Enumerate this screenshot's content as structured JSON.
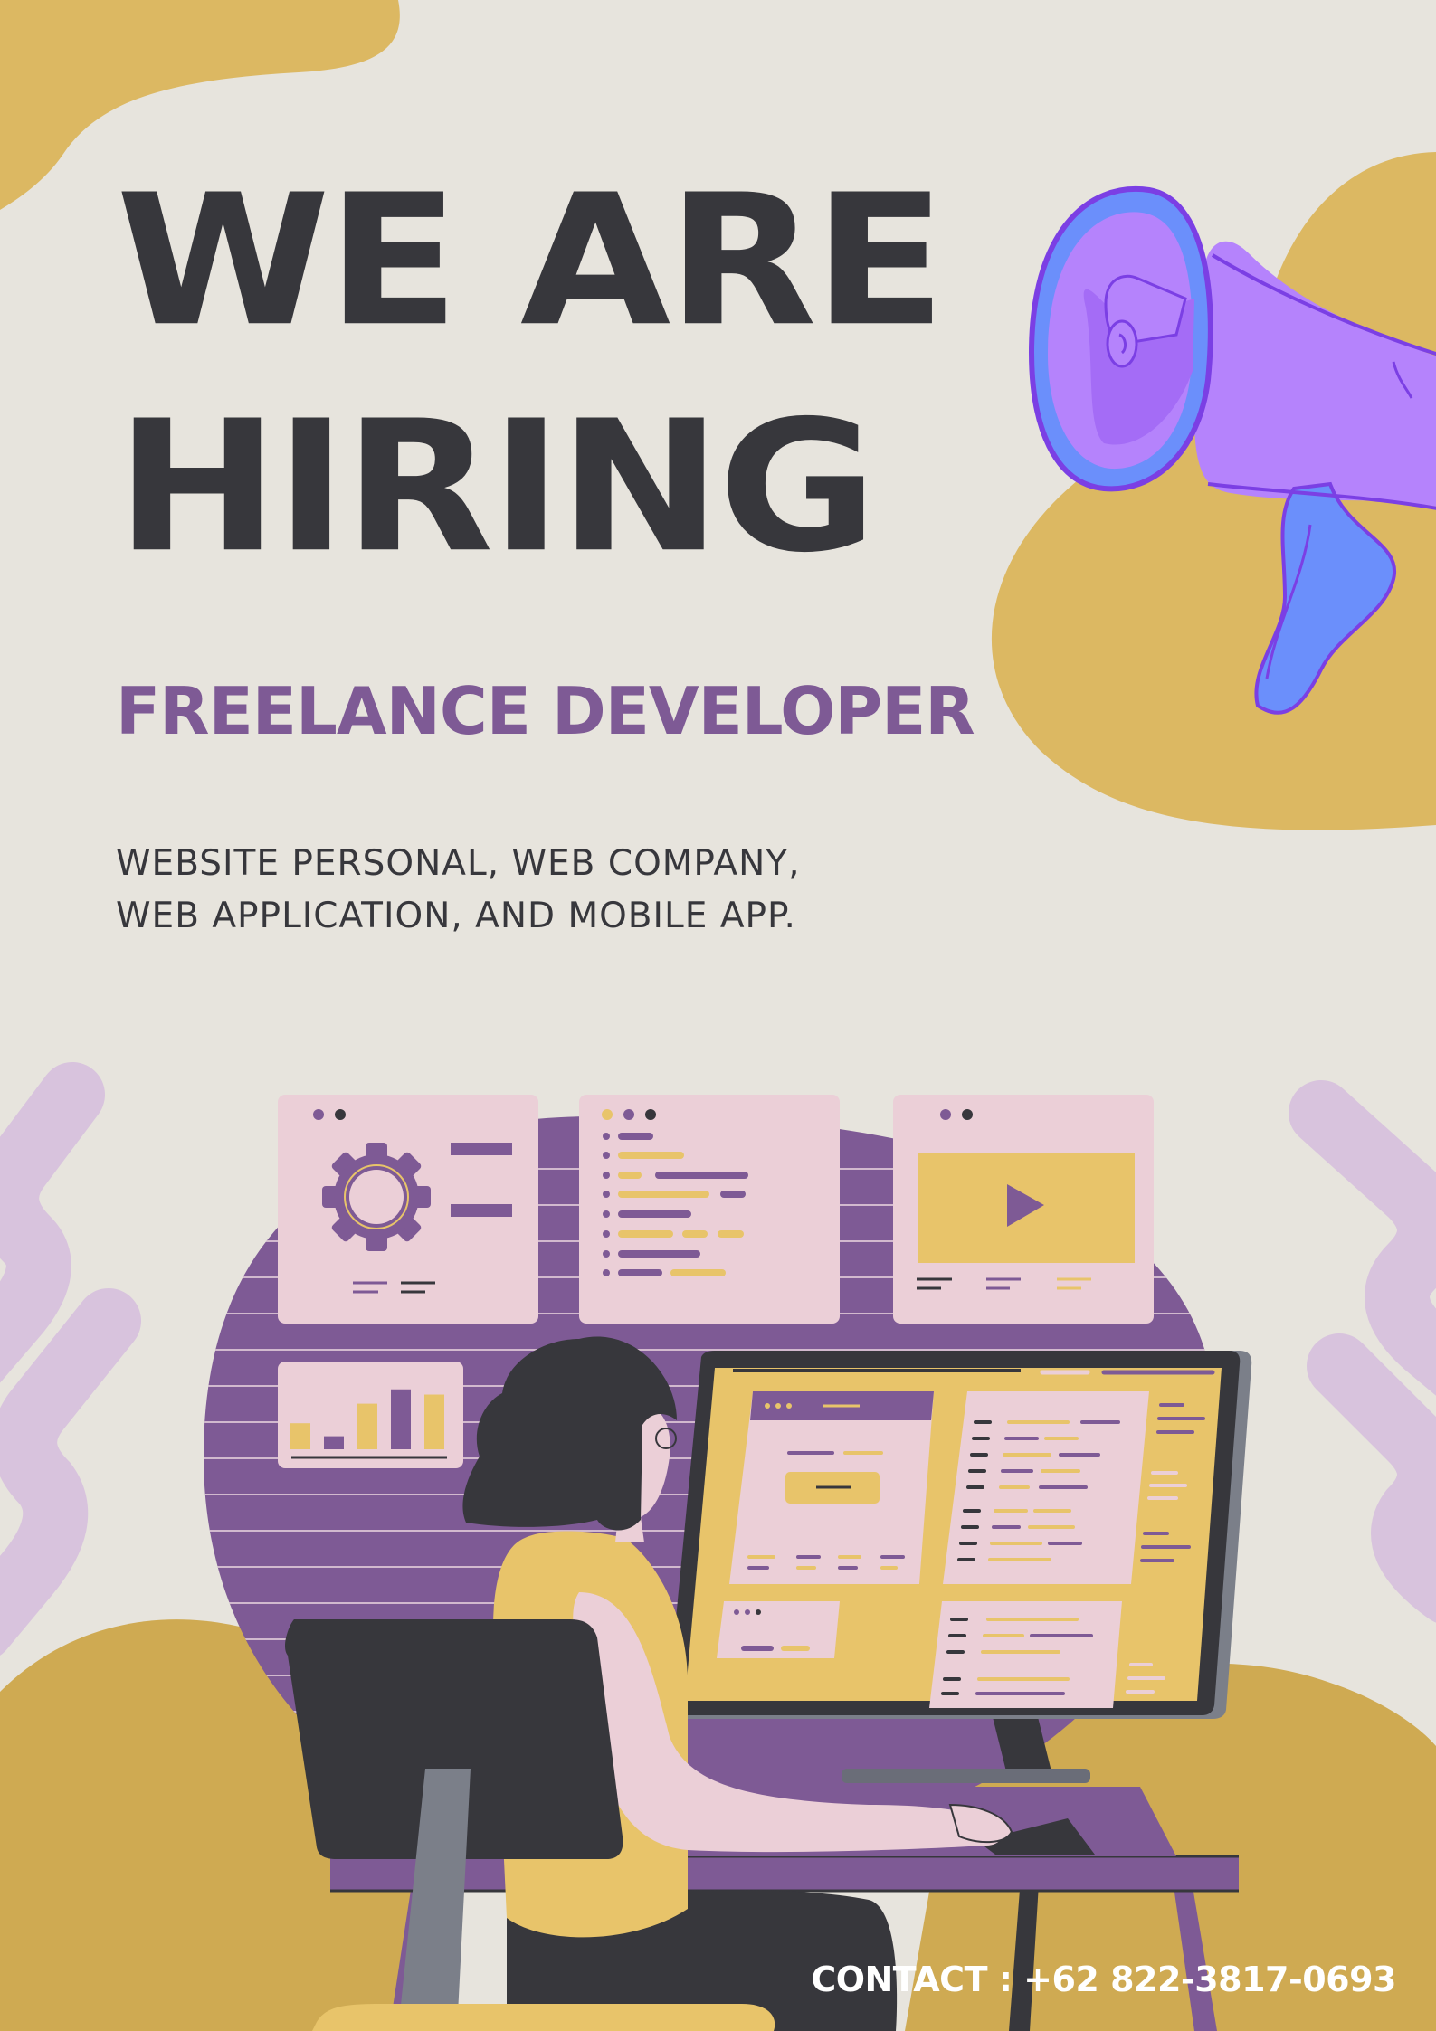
{
  "headline": {
    "line1": "WE ARE",
    "line2": "HIRING"
  },
  "role": "FREELANCE DEVELOPER",
  "description": {
    "line1": "WEBSITE PERSONAL, WEB COMPANY,",
    "line2": "WEB APPLICATION, AND MOBILE APP."
  },
  "contact": {
    "label": "CONTACT :",
    "phone": "+62 822-3817-0693"
  },
  "colors": {
    "background": "#e7e4dd",
    "text_dark": "#37373c",
    "accent_purple": "#7e5a95",
    "accent_gold": "#dcb862",
    "lavender": "#d8c3dd",
    "megaphone": "#b583fc"
  },
  "icons": [
    "megaphone-icon",
    "gear-icon",
    "play-icon",
    "bar-chart-icon"
  ],
  "chart_card": {
    "values": [
      2,
      1,
      3.5,
      4.6,
      4.2
    ]
  }
}
